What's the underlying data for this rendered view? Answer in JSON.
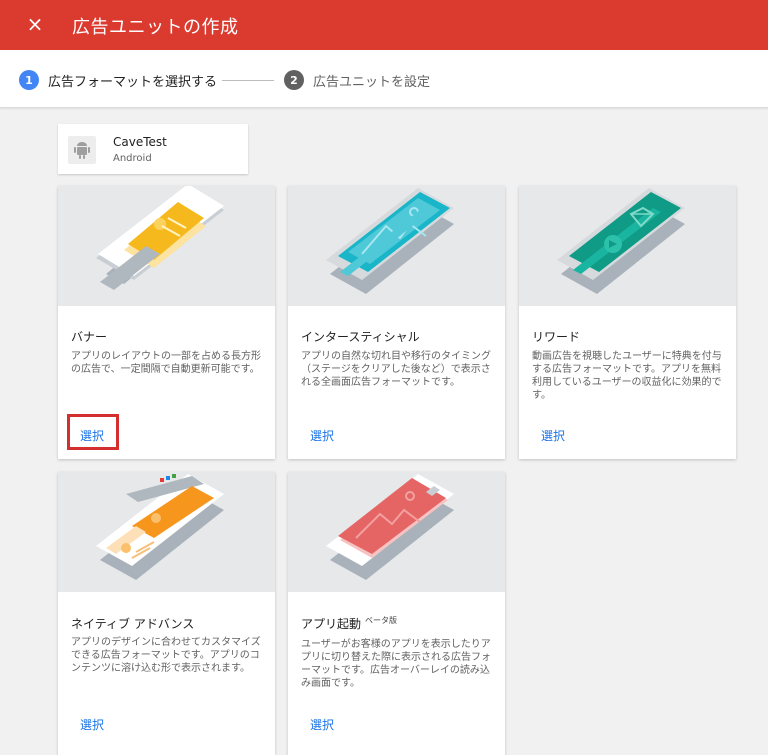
{
  "header": {
    "close_icon": "×",
    "title": "広告ユニットの作成"
  },
  "stepper": {
    "steps": [
      {
        "num": "1",
        "label": "広告フォーマットを選択する"
      },
      {
        "num": "2",
        "label": "広告ユニットを設定"
      }
    ]
  },
  "app": {
    "name": "CaveTest",
    "platform": "Android",
    "icon": "android-icon"
  },
  "formats": [
    {
      "title": "バナー",
      "badge": "",
      "desc": "アプリのレイアウトの一部を占める長方形の広告で、一定間隔で自動更新可能です。",
      "select_label": "選択",
      "highlighted": true,
      "accent": "#f6b91d"
    },
    {
      "title": "インタースティシャル",
      "badge": "",
      "desc": "アプリの自然な切れ目や移行のタイミング（ステージをクリアした後など）で表示される全画面広告フォーマットです。",
      "select_label": "選択",
      "highlighted": false,
      "accent": "#19b5c9"
    },
    {
      "title": "リワード",
      "badge": "",
      "desc": "動画広告を視聴したユーザーに特典を付与する広告フォーマットです。アプリを無料利用しているユーザーの収益化に効果的です。",
      "select_label": "選択",
      "highlighted": false,
      "accent": "#0f9b86"
    },
    {
      "title": "ネイティブ アドバンス",
      "badge": "",
      "desc": "アプリのデザインに合わせてカスタマイズできる広告フォーマットです。アプリのコンテンツに溶け込む形で表示されます。",
      "select_label": "選択",
      "highlighted": false,
      "accent": "#f7961d"
    },
    {
      "title": "アプリ起動",
      "badge": "ベータ版",
      "desc": "ユーザーがお客様のアプリを表示したりアプリに切り替えた際に表示される広告フォーマットです。広告オーバーレイの読み込み画面です。",
      "select_label": "選択",
      "highlighted": false,
      "accent": "#e56565"
    }
  ],
  "colors": {
    "header": "#db3a2f",
    "link": "#1a73e8",
    "step_active": "#4285f4",
    "highlight": "#d32f2f"
  }
}
